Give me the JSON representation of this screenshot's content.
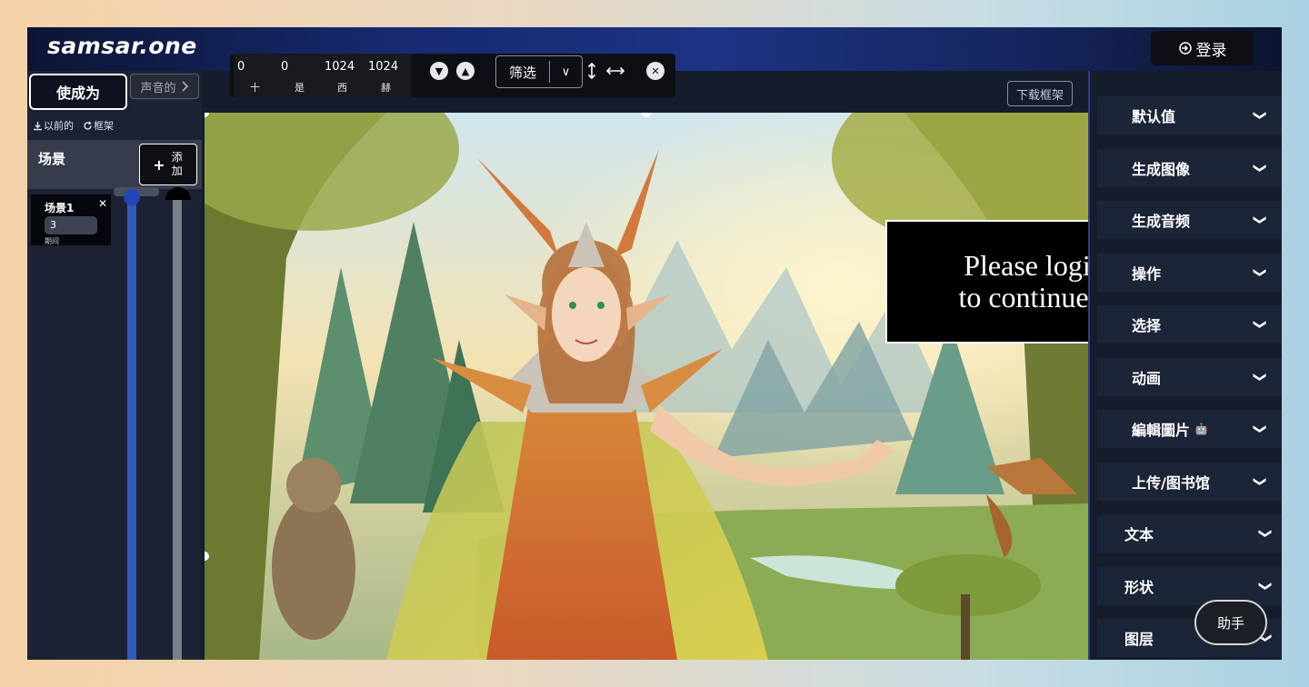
{
  "header": {
    "brand": "samsar.one",
    "login_label": "登录"
  },
  "toolbar": {
    "coords": [
      {
        "value": "0",
        "label": "十"
      },
      {
        "value": "0",
        "label": "是"
      },
      {
        "value": "1024",
        "label": "西"
      },
      {
        "value": "1024",
        "label": "赫"
      }
    ],
    "filter_label": "筛选"
  },
  "left": {
    "make_label": "使成为",
    "sound_label": "声音的",
    "prev_label": "以前的",
    "frame_label": "框架",
    "scenes_title": "场景",
    "add_label": "添加",
    "scene": {
      "name": "场景1",
      "duration": "3",
      "duration_label": "期间"
    }
  },
  "canvas": {
    "download_label": "下载框架",
    "overlay_line1": "Please login",
    "overlay_line2": "to continue .."
  },
  "right": {
    "items": [
      {
        "label": "默认值"
      },
      {
        "label": "生成图像"
      },
      {
        "label": "生成音频"
      },
      {
        "label": "操作"
      },
      {
        "label": "选择"
      },
      {
        "label": "动画"
      },
      {
        "label": "編輯圖片"
      },
      {
        "label": "上传/图书馆"
      },
      {
        "label": "文本"
      },
      {
        "label": "形状"
      },
      {
        "label": "图层"
      }
    ]
  },
  "helper_label": "助手",
  "colors": {
    "accent": "#2a3d8c",
    "panel": "#1c2437",
    "toolbar": "#0d0f14"
  }
}
